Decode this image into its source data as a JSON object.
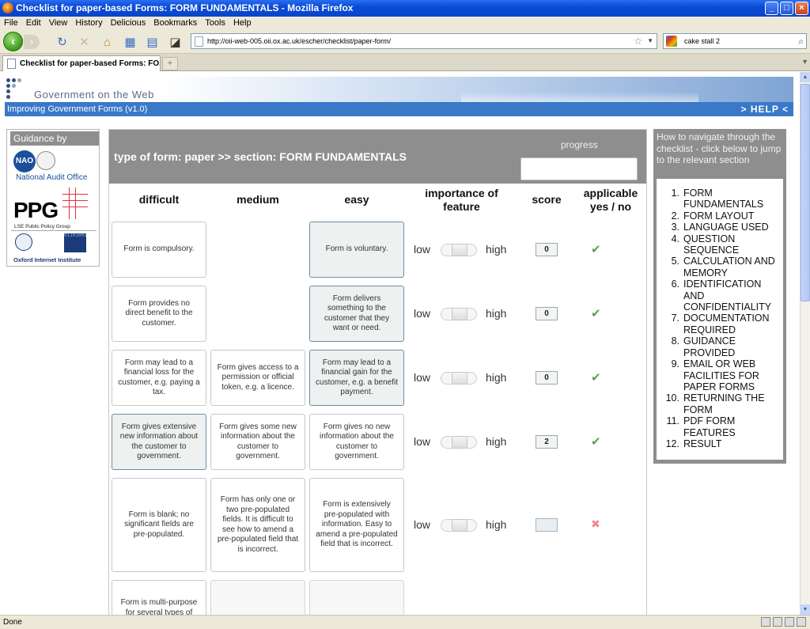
{
  "window": {
    "title": "Checklist for paper-based Forms: FORM FUNDAMENTALS - Mozilla Firefox"
  },
  "menu": [
    "File",
    "Edit",
    "View",
    "History",
    "Delicious",
    "Bookmarks",
    "Tools",
    "Help"
  ],
  "browser": {
    "url": "http://oii-web-005.oii.ox.ac.uk/escher/checklist/paper-form/",
    "search_value": "cake stall 2",
    "tab_label": "Checklist for paper-based Forms: FO...",
    "status": "Done"
  },
  "site": {
    "banner_title": "Government on the Web",
    "subtitle": "Improving Government Forms (v1.0)",
    "help": "> HELP <"
  },
  "guidance": {
    "heading": "Guidance by",
    "nao_logo": "NAO",
    "nao_name": "National Audit Office",
    "ppg_logo": "PPG",
    "ppg_name": "LSE Public Policy Group",
    "oii_name": "Oxford Internet Institute"
  },
  "checklist": {
    "heading": "type of form: paper >> section: FORM FUNDAMENTALS",
    "progress_label": "progress",
    "progress_value": 0,
    "columns": {
      "difficult": "difficult",
      "medium": "medium",
      "easy": "easy",
      "importance": "importance of feature",
      "score": "score",
      "applicable": "applicable yes / no"
    },
    "low": "low",
    "high": "high",
    "rows": [
      {
        "difficult": "Form is compulsory.",
        "medium": "",
        "easy": "Form is voluntary.",
        "selected": "easy",
        "importance": 0.5,
        "score": "0",
        "applicable": "yes"
      },
      {
        "difficult": "Form provides no direct benefit to the customer.",
        "medium": "",
        "easy": "Form delivers something to the customer that they want or need.",
        "selected": "easy",
        "importance": 0.5,
        "score": "0",
        "applicable": "yes"
      },
      {
        "difficult": "Form may lead to a financial loss for the customer, e.g. paying a tax.",
        "medium": "Form gives access to a permission or official token, e.g. a licence.",
        "easy": "Form may lead to a financial gain for the customer, e.g. a benefit payment.",
        "selected": "easy",
        "importance": 0.5,
        "score": "0",
        "applicable": "yes"
      },
      {
        "difficult": "Form gives extensive new information about the customer to government.",
        "medium": "Form gives some new information about the customer to government.",
        "easy": "Form gives no new information about the customer to government.",
        "selected": "difficult",
        "importance": 0.5,
        "score": "2",
        "applicable": "yes"
      },
      {
        "difficult": "Form is blank; no significant fields are pre-populated.",
        "medium": "Form has only one or two pre-populated fields. It is difficult to see how to amend a pre-populated field that is incorrect.",
        "easy": "Form is extensively pre-populated with information. Easy to amend a pre-populated field that is incorrect.",
        "selected": "",
        "importance": 0.5,
        "score": "",
        "applicable": "no"
      },
      {
        "difficult": "Form is multi-purpose for several types of",
        "medium": "",
        "easy": "",
        "selected": "",
        "importance": 0.5,
        "score": "",
        "applicable": ""
      }
    ]
  },
  "navigator": {
    "heading": "How to navigate through the checklist - click below to jump to the relevant section",
    "items": [
      {
        "n": "1.",
        "label": "FORM FUNDAMENTALS"
      },
      {
        "n": "2.",
        "label": "FORM LAYOUT"
      },
      {
        "n": "3.",
        "label": "LANGUAGE USED"
      },
      {
        "n": "4.",
        "label": "QUESTION SEQUENCE"
      },
      {
        "n": "5.",
        "label": "CALCULATION AND MEMORY"
      },
      {
        "n": "6.",
        "label": "IDENTIFICATION AND CONFIDENTIALITY"
      },
      {
        "n": "7.",
        "label": "DOCUMENTATION REQUIRED"
      },
      {
        "n": "8.",
        "label": "GUIDANCE PROVIDED"
      },
      {
        "n": "9.",
        "label": "EMAIL OR WEB FACILITIES FOR PAPER FORMS"
      },
      {
        "n": "10.",
        "label": "RETURNING THE FORM"
      },
      {
        "n": "11.",
        "label": "PDF FORM FEATURES"
      },
      {
        "n": "12.",
        "label": "RESULT"
      }
    ]
  },
  "colors": {
    "titlebar": "#0a4bd8",
    "header_grey": "#8e8e8e",
    "accent_blue": "#3a78c8",
    "check_green": "#5ba04a",
    "cross_red": "#f08a8a"
  }
}
